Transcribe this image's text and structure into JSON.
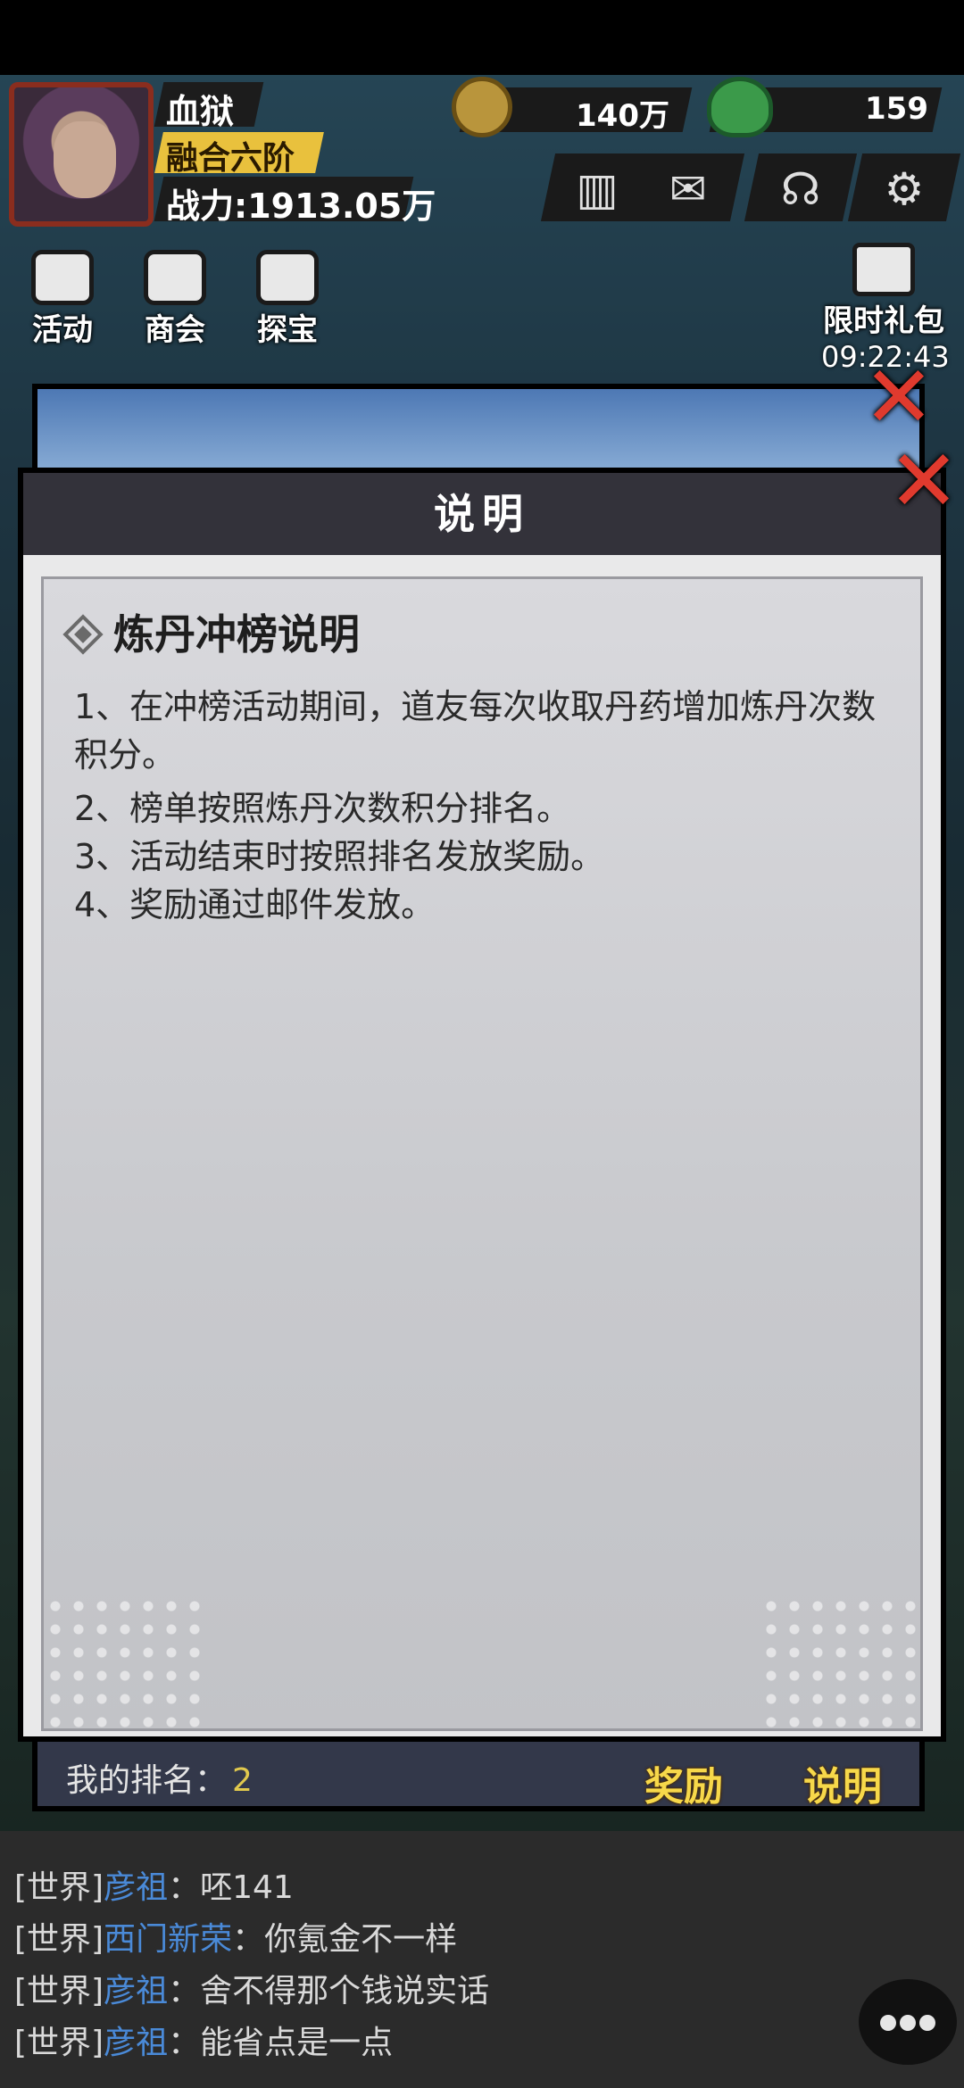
{
  "player": {
    "name": "血狱",
    "rank": "融合六阶",
    "power": "战力:1913.05万"
  },
  "resources": {
    "coins": "140万",
    "gems": "159"
  },
  "top_buttons": [
    "ranking-icon",
    "mail-icon",
    "headset-icon",
    "gear-icon"
  ],
  "events": [
    {
      "label": "活动",
      "icon": "balloon-icon"
    },
    {
      "label": "商会",
      "icon": "lantern-icon"
    },
    {
      "label": "探宝",
      "icon": "gate-icon"
    }
  ],
  "limited_gift": {
    "label": "限时礼包",
    "timer": "09:22:43"
  },
  "back_panel": {
    "my_rank_label": "我的排名：",
    "my_rank_value": "2",
    "reward_button": "奖励",
    "info_button": "说明"
  },
  "modal": {
    "title": "说明",
    "section_title": "炼丹冲榜说明",
    "rules": [
      "1、在冲榜活动期间，道友每次收取丹药增加炼丹次数积分。",
      "2、榜单按照炼丹次数积分排名。",
      "3、活动结束时按照排名发放奖励。",
      "4、奖励通过邮件发放。"
    ],
    "close_label": "✕"
  },
  "chat": [
    {
      "channel": "[世界]",
      "name": "彦祖",
      "message": "：呸141"
    },
    {
      "channel": "[世界]",
      "name": "西门新荣",
      "message": "：你氪金不一样"
    },
    {
      "channel": "[世界]",
      "name": "彦祖",
      "message": "：舍不得那个钱说实话"
    },
    {
      "channel": "[世界]",
      "name": "彦祖",
      "message": "：能省点是一点"
    }
  ],
  "colors": {
    "accent_gold": "#e9c13d",
    "close_red": "#e03a2e",
    "chat_name_blue": "#4a8ad8",
    "modal_header": "#33323a"
  }
}
